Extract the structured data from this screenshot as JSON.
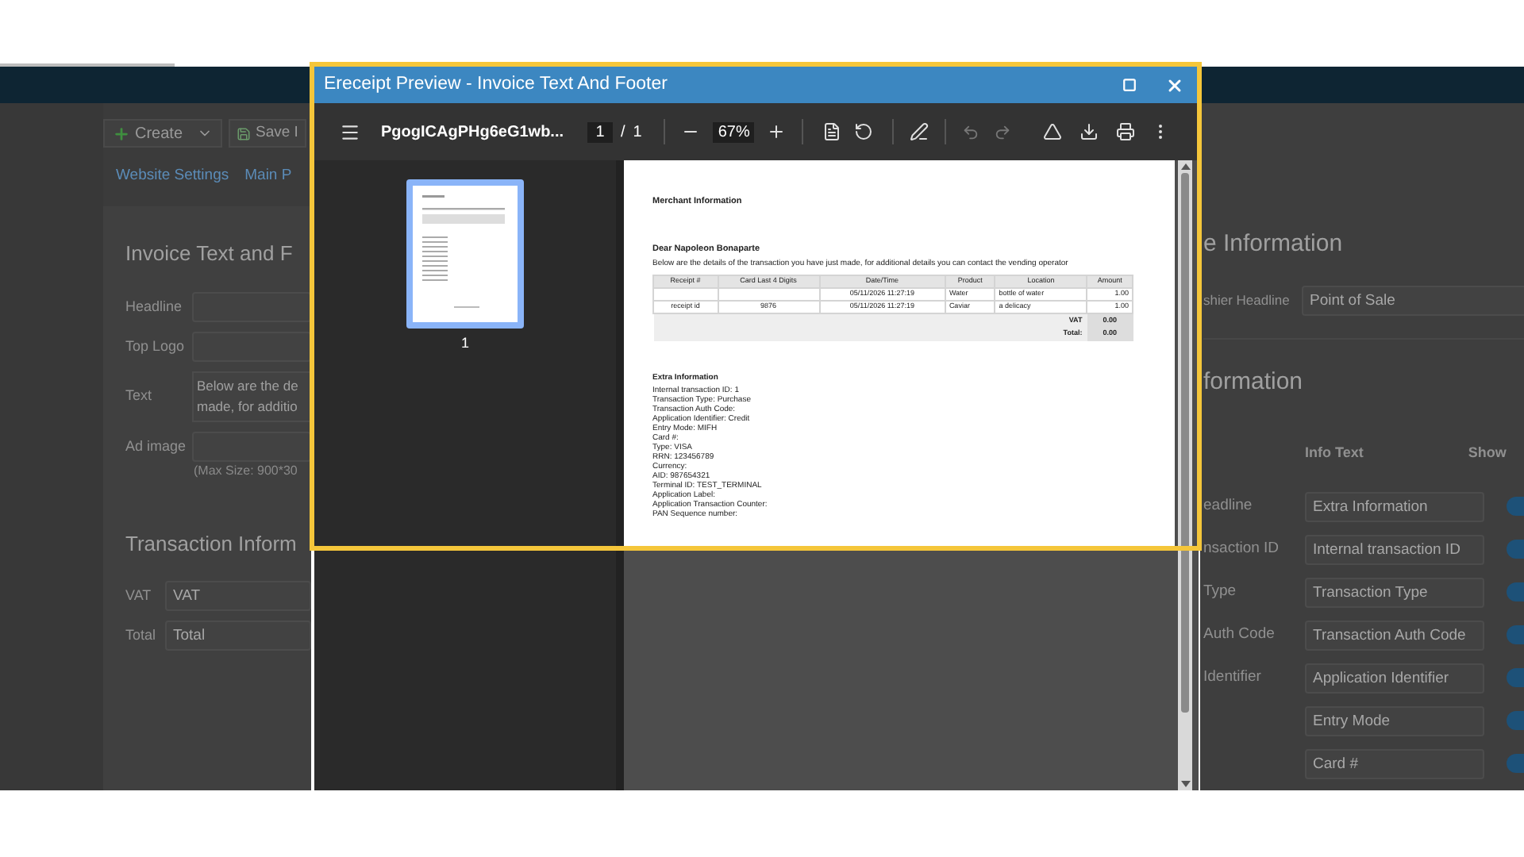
{
  "page": {
    "create_button": "Create",
    "save_button": "Save I",
    "tabs": [
      "Website Settings",
      "Main P"
    ],
    "invoice_section": {
      "heading": "Invoice Text and F",
      "fields": [
        {
          "kind": "input",
          "label": "Headline"
        },
        {
          "kind": "input",
          "label": "Top Logo"
        },
        {
          "kind": "textarea",
          "label": "Text",
          "lines": [
            "Below are the de",
            "made, for additio"
          ]
        },
        {
          "kind": "input",
          "label": "Ad image",
          "hint": "(Max Size: 900*30"
        }
      ]
    },
    "transaction_section": {
      "heading": "Transaction Inform",
      "fields": [
        {
          "label": "VAT",
          "value": "VAT"
        },
        {
          "label": "Total",
          "value": "Total"
        }
      ]
    },
    "cashier_section": {
      "heading": "e Information",
      "label": "shier Headline",
      "value": "Point of Sale"
    },
    "info_section": {
      "heading": "formation",
      "columns": [
        "Info Text",
        "Show"
      ],
      "rows": [
        {
          "label": "eadline",
          "value": "Extra Information",
          "on": true
        },
        {
          "label": "nsaction ID",
          "value": "Internal transaction ID",
          "on": true
        },
        {
          "label": "Type",
          "value": "Transaction Type",
          "on": true
        },
        {
          "label": "Auth Code",
          "value": "Transaction Auth Code",
          "on": true
        },
        {
          "label": "Identifier",
          "value": "Application Identifier",
          "on": true
        },
        {
          "value": "Entry Mode",
          "on": true
        },
        {
          "value": "Card #",
          "on": true
        }
      ]
    }
  },
  "dialog": {
    "title": "Ereceipt Preview - Invoice Text And Footer",
    "toolbar": {
      "file_name": "PgogICAgPHg6eG1wb...",
      "page_input": "1",
      "page_separator": "/",
      "page_count": "1",
      "zoom": "67%",
      "undo_disabled": true,
      "redo_disabled": true
    },
    "thumbnails": [
      {
        "label": "1",
        "selected": true
      }
    ],
    "document": {
      "merchant_heading": "Merchant Information",
      "greeting": "Dear Napoleon Bonaparte",
      "intro": "Below are the details of the transaction you have just made, for additional details you can contact the vending operator",
      "table": {
        "columns": [
          "Receipt #",
          "Card Last 4 Digits",
          "Date/Time",
          "Product",
          "Location",
          "Amount"
        ],
        "rows": [
          [
            null,
            null,
            "05/11/2026 11:27:19",
            "Water",
            "bottle of water",
            "1.00"
          ],
          [
            "receipt id",
            "9876",
            "05/11/2026 11:27:19",
            "Caviar",
            "a delicacy",
            "1.00"
          ]
        ],
        "totals": [
          {
            "label": "VAT",
            "value": "0.00"
          },
          {
            "label": "Total:",
            "value": "0.00"
          }
        ]
      },
      "extra_heading": "Extra Information",
      "extra_lines": [
        "Internal transaction ID: 1",
        "Transaction Type: Purchase",
        "Transaction Auth Code:",
        "Application Identifier: Credit",
        "Entry Mode: MIFH",
        "Card #:",
        "Type: VISA",
        "RRN: 123456789",
        "Currency:",
        "AID: 987654321",
        "Terminal ID: TEST_TERMINAL",
        "Application Label:",
        "Application Transaction Counter:",
        "PAN Sequence number:"
      ]
    }
  }
}
